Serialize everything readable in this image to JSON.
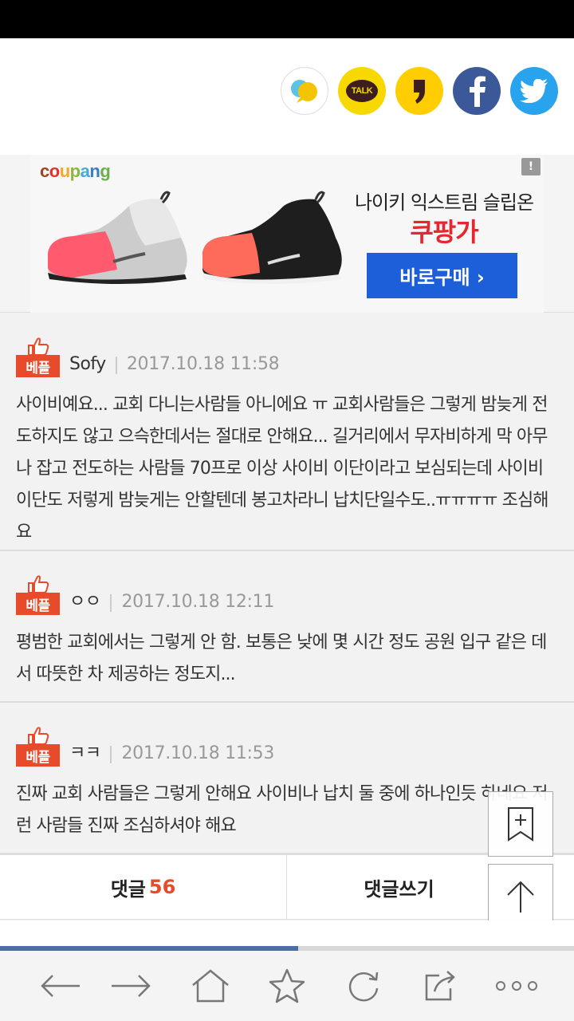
{
  "share": {
    "icons": [
      "kakao-story-color-icon",
      "kakao-talk-icon",
      "kakao-story-icon",
      "facebook-icon",
      "twitter-icon"
    ],
    "talk_label": "TALK"
  },
  "ad": {
    "brand": "coupang",
    "title": "나이키 익스트림 슬립온",
    "subtitle": "쿠팡가",
    "button_label": "바로구매 ›",
    "info_badge": "!"
  },
  "comments": [
    {
      "badge": "베플",
      "author": "Sofy",
      "date": "2017.10.18 11:58",
      "text": "사이비예요... 교회 다니는사람들 아니에요 ㅠ 교회사람들은 그렇게 밤늦게 전도하지도 않고 으슥한데서는 절대로 안해요... 길거리에서 무자비하게 막 아무나 잡고 전도하는 사람들 70프로 이상 사이비 이단이라고 보심되는데 사이비 이단도 저렇게 밤늦게는 안할텐데 봉고차라니 납치단일수도..ㅠㅠㅠㅠ 조심해요"
    },
    {
      "badge": "베플",
      "author": "ㅇㅇ",
      "date": "2017.10.18 12:11",
      "text": "평범한 교회에서는 그렇게 안 함. 보통은 낮에 몇 시간 정도 공원 입구 같은 데서 따뜻한 차 제공하는 정도지..."
    },
    {
      "badge": "베플",
      "author": "ㅋㅋ",
      "date": "2017.10.18 11:53",
      "text": "진짜 교회 사람들은 그렇게 안해요 사이비나 납치 둘 중에 하나인듯 하네요 저런 사람들 진짜 조심하셔야 해요"
    }
  ],
  "bottom_bar": {
    "comment_label": "댓글",
    "comment_count": "56",
    "write_label": "댓글쓰기"
  },
  "scroll_progress": 0.52,
  "colors": {
    "best_badge": "#e84b2c",
    "ad_button": "#1c5fd8",
    "ad_price": "#e8262d",
    "facebook": "#3b5998",
    "twitter": "#2aa3ef",
    "kakao_yellow": "#f7d800"
  }
}
